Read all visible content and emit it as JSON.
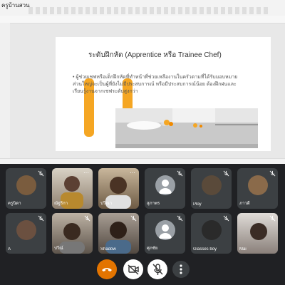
{
  "window": {
    "title": "ครูบ้านสวน"
  },
  "slide": {
    "title": "ระดับฝึกหัด (Apprentice หรือ Trainee Chef)",
    "bullet": "• ผู้ช่วยเชฟหรือเด็กฝึกหัดที่ทำหน้าที่ช่วยเหลืองานในครัวตามที่ได้รับมอบหมาย ส่วนใหญ่จะเป็นผู้ที่ยังไม่มีประสบการณ์ หรือมีประสบการณ์น้อย ต้องฝึกฝนและเรียนรู้งานจากเชฟระดับสูงกว่า"
  },
  "participants_row1": [
    {
      "name": "ครูนิดา",
      "kind": "avatar"
    },
    {
      "name": "ณัฐริกา",
      "kind": "video"
    },
    {
      "name": "ปวีณา",
      "kind": "video"
    },
    {
      "name": "สุภาพร",
      "kind": "default"
    },
    {
      "name": "Ploy",
      "kind": "avatar"
    },
    {
      "name": "ภาวดี",
      "kind": "avatar"
    }
  ],
  "participants_row2": [
    {
      "name": "A",
      "kind": "avatar"
    },
    {
      "name": "ปวีณ์",
      "kind": "video"
    },
    {
      "name": "Shadow",
      "kind": "video"
    },
    {
      "name": "ศุภชัย",
      "kind": "default"
    },
    {
      "name": "Glasses boy",
      "kind": "avatar"
    },
    {
      "name": "Mai",
      "kind": "video"
    }
  ],
  "controls": {
    "end_call": "end-call",
    "camera": "camera-off",
    "mic": "mic-off",
    "more": "more"
  },
  "colors": {
    "accent": "#f5a623",
    "end_call": "#e37400",
    "tile": "#3c4043",
    "bg": "#202124"
  }
}
